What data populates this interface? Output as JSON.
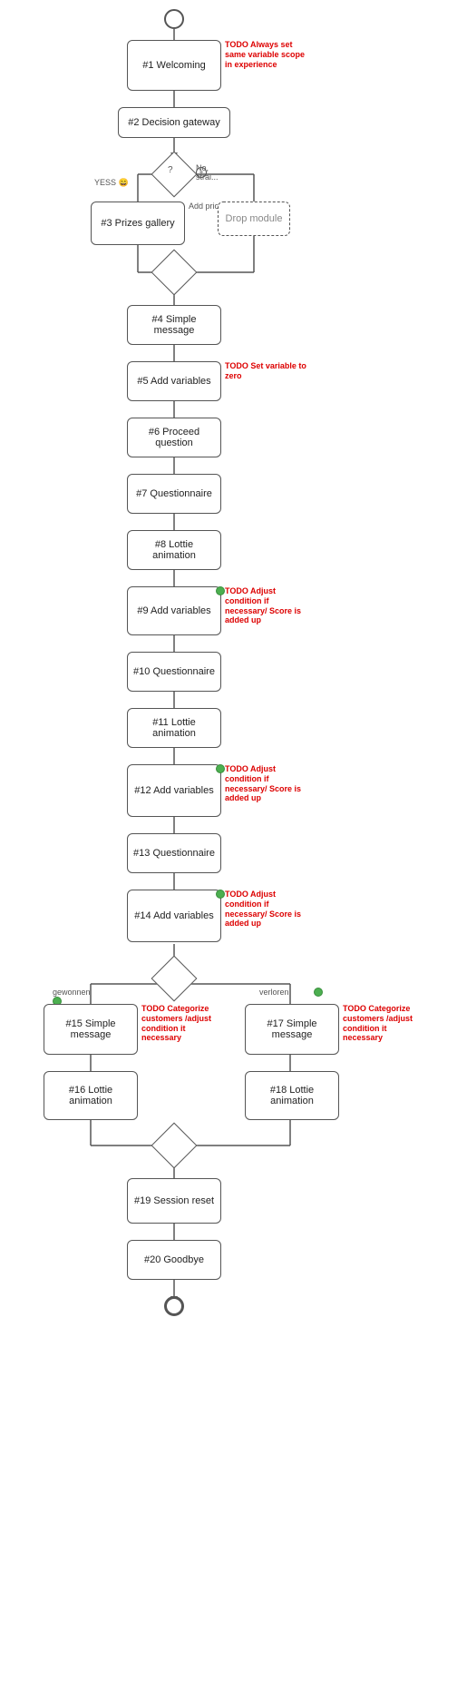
{
  "nodes": {
    "start_circle": {
      "label": ""
    },
    "n1": {
      "label": "#1 Welcoming"
    },
    "n2": {
      "label": "#2 Decision gateway"
    },
    "n3": {
      "label": "#3 Prizes gallery"
    },
    "drop": {
      "label": "Drop module"
    },
    "n4": {
      "label": "#4 Simple message"
    },
    "n5": {
      "label": "#5 Add variables"
    },
    "n6": {
      "label": "#6 Proceed question"
    },
    "n7": {
      "label": "#7 Questionnaire"
    },
    "n8": {
      "label": "#8 Lottie animation"
    },
    "n9": {
      "label": "#9 Add variables"
    },
    "n10": {
      "label": "#10 Questionnaire"
    },
    "n11": {
      "label": "#11 Lottie animation"
    },
    "n12": {
      "label": "#12 Add variables"
    },
    "n13": {
      "label": "#13 Questionnaire"
    },
    "n14": {
      "label": "#14 Add variables"
    },
    "n15": {
      "label": "#15 Simple message"
    },
    "n16": {
      "label": "#16 Lottie animation"
    },
    "n17": {
      "label": "#17 Simple message"
    },
    "n18": {
      "label": "#18 Lottie animation"
    },
    "n19": {
      "label": "#19 Session reset"
    },
    "n20": {
      "label": "#20 Goodbye"
    },
    "end_circle": {
      "label": ""
    }
  },
  "todos": {
    "t1": "TODO Always set same variable scope in experience",
    "t5": "TODO Set variable to zero",
    "t9": "TODO Adjust condition if necessary/ Score is added up",
    "t12": "TODO Adjust condition if necessary/ Score is added up",
    "t14": "TODO Adjust condition if necessary/ Score is added up",
    "t15": "TODO Categorize customers /adjust condition it necessary",
    "t17": "TODO Categorize customers /adjust condition it necessary"
  },
  "branch_labels": {
    "yess": "YESS 😄",
    "no": "No, strai...",
    "add_prices": "Add prices",
    "gewonnen": "gewonnen",
    "verloren": "verloren"
  }
}
